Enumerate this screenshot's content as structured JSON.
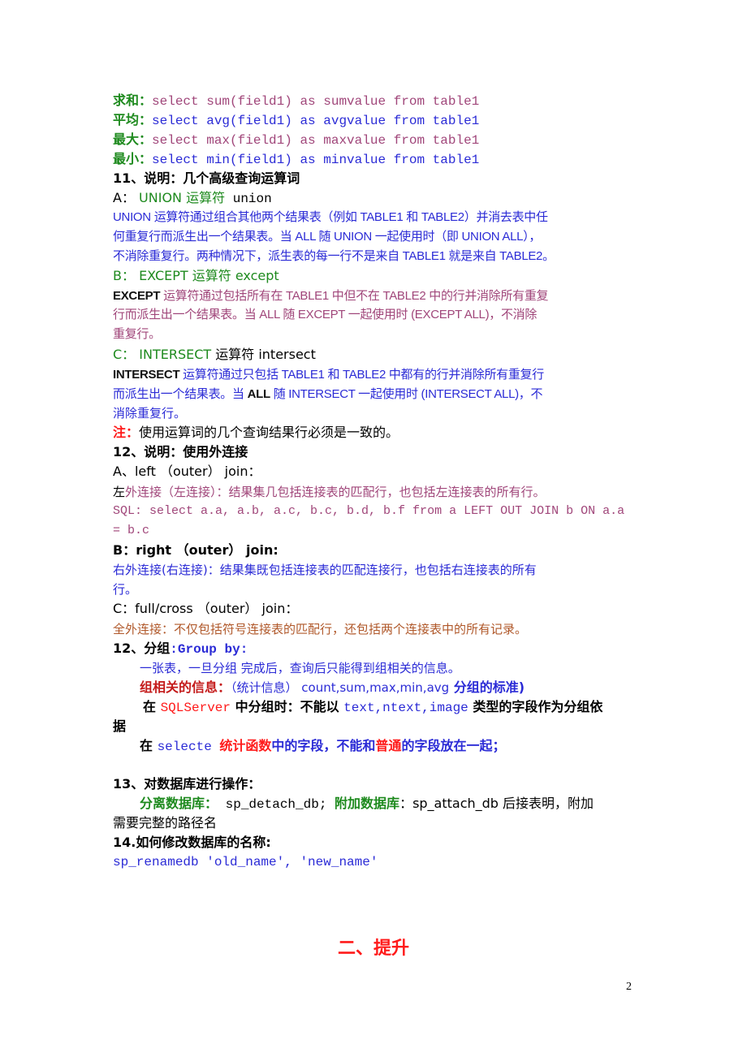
{
  "agg": [
    {
      "label": "求和：",
      "sql": "select sum(field1) as sumvalue from table1",
      "color": "plum"
    },
    {
      "label": "平均：",
      "sql": "select avg(field1) as avgvalue from table1",
      "color": "blue"
    },
    {
      "label": "最大：",
      "sql": "select max(field1) as maxvalue from table1",
      "color": "plum"
    },
    {
      "label": "最小：",
      "sql": "select min(field1) as minvalue from table1",
      "color": "blue"
    }
  ],
  "s11": {
    "title": "11、说明：几个高级查询运算词",
    "a_prefix": "A：",
    "a_kw": "UNION 运算符",
    "a_suffix": " union",
    "a_desc": [
      "UNION 运算符通过组合其他两个结果表（例如 TABLE1 和 TABLE2）并消去表中任",
      "何重复行而派生出一个结果表。当 ALL 随 UNION 一起使用时（即 UNION ALL），",
      "不消除重复行。两种情况下，派生表的每一行不是来自 TABLE1 就是来自 TABLE2。"
    ],
    "b_line": "B： EXCEPT 运算符 except",
    "b_kw": "EXCEPT",
    "b_desc": [
      " 运算符通过包括所有在 TABLE1 中但不在 TABLE2 中的行并消除所有重复",
      "行而派生出一个结果表。当 ALL 随 EXCEPT 一起使用时 (EXCEPT ALL)，不消除",
      "重复行。"
    ],
    "c_prefix": "C： ",
    "c_kw": "INTERSECT",
    "c_suffix": " 运算符 intersect",
    "c_lead": "INTERSECT",
    "c_desc": [
      " 运算符通过只包括 TABLE1 和 TABLE2 中都有的行并消除所有重复行",
      "而派生出一个结果表。当 ",
      "ALL",
      " 随 INTERSECT 一起使用时 (INTERSECT ALL)，不",
      "消除重复行。"
    ],
    "note_label": "注：",
    "note_text": "使用运算词的几个查询结果行必须是一致的。"
  },
  "s12": {
    "title": "12、说明：使用外连接",
    "a_line": "A、left （outer） join：",
    "a_first": "左",
    "a_desc": "外连接（左连接）：结果集几包括连接表的匹配行，也包括左连接表的所有行。",
    "a_sql_1": "SQL: select a.a, a.b, a.c, b.c, b.d, b.f from a LEFT OUT JOIN b ON a.a",
    "a_sql_2": "= b.c",
    "b_line": "B：right （outer） join:",
    "b_desc_1": "右外连接(右连接)：结果集既包括连接表的匹配连接行，也包括右连接表的所有",
    "b_desc_2": "行。",
    "c_line": "C：full/cross （outer） join：",
    "c_desc": "全外连接：不仅包括符号连接表的匹配行，还包括两个连接表中的所有记录。"
  },
  "group": {
    "title": "12、分组",
    "title_kw": ":Group by:",
    "line1": "一张表，一旦分组 完成后，查询后只能得到组相关的信息。",
    "info_label": "组相关的信息：",
    "info_paren": "（统计信息） count,sum,max,min,avg",
    "info_std": "  分组的标准)",
    "rule_pre": "在 ",
    "rule_sqlserver": "SQLServer",
    "rule_mid": " 中分组时：不能以 ",
    "rule_types": "text,ntext,image",
    "rule_post": " 类型的字段作为分组依",
    "rule_tail": "据",
    "sel_pre": "在 ",
    "sel_kw": "selecte ",
    "sel_red1": "统计函数",
    "sel_mid": "中的字段，不能和",
    "sel_red2": "普通",
    "sel_post": "的字段放在一起；"
  },
  "s13": {
    "title": "13、对数据库进行操作：",
    "detach_label": "分离数据库：",
    "detach_cmd": "  sp_detach_db; ",
    "attach_label": "附加数据库",
    "attach_cmd": "：sp_attach_db 后接表明，附加",
    "tail": "需要完整的路径名"
  },
  "s14": {
    "title": "14.如何修改数据库的名称:",
    "cmd": "sp_renamedb 'old_name', 'new_name'"
  },
  "heading": "二、提升",
  "page_number": "2"
}
